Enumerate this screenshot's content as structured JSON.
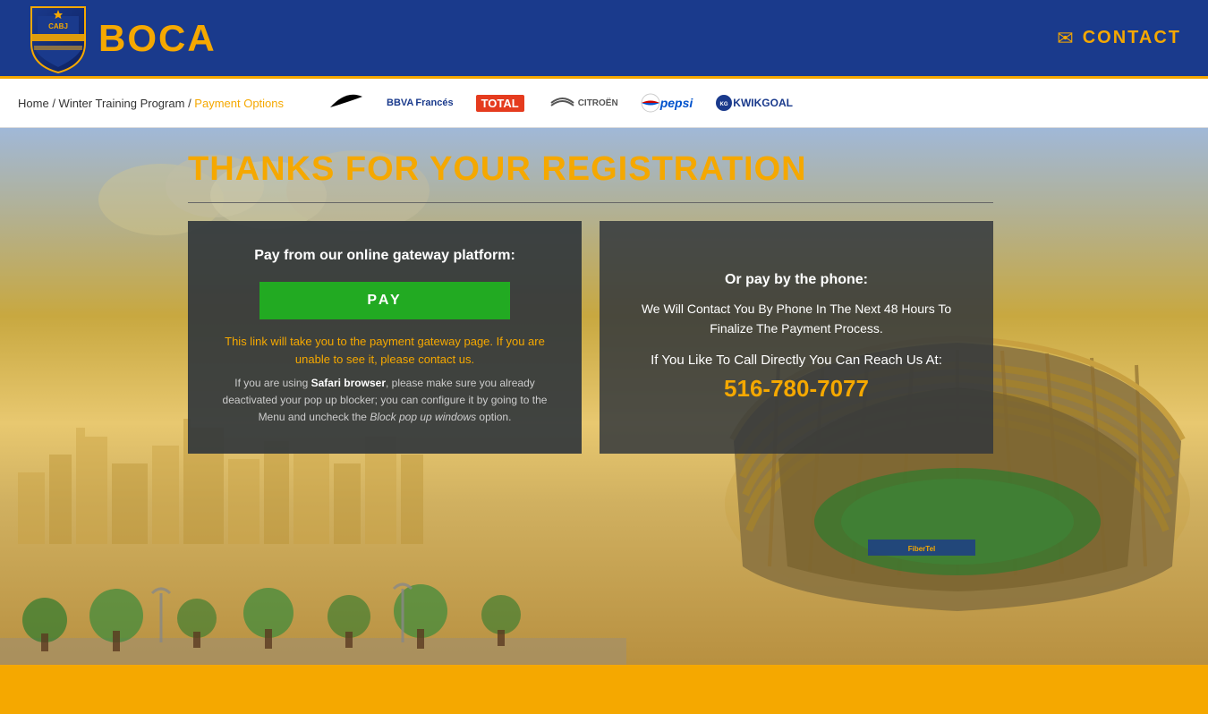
{
  "header": {
    "logo_text": "BOCA",
    "contact_label": "CONTACT",
    "contact_icon": "✉"
  },
  "nav": {
    "breadcrumb": {
      "home": "Home",
      "program": "Winter Training Program",
      "current": "Payment Options",
      "separator": "/"
    },
    "sponsors": [
      {
        "name": "Nike",
        "display": "✓",
        "type": "nike"
      },
      {
        "name": "BBVA Francés",
        "display": "BBVA Francés",
        "type": "bbva"
      },
      {
        "name": "Total",
        "display": "TOTAL",
        "type": "total"
      },
      {
        "name": "Citroën",
        "display": "CITROËN",
        "type": "citroen"
      },
      {
        "name": "Pepsi",
        "display": "pepsi",
        "type": "pepsi"
      },
      {
        "name": "KwikGoal",
        "display": "KWIKGOAL",
        "type": "kwikgoal"
      }
    ]
  },
  "main": {
    "page_title": "THANKS FOR YOUR REGISTRATION",
    "card_left": {
      "title": "Pay from our online gateway platform:",
      "pay_button": "PAY",
      "warning": "This link will take you to the payment gateway page. If you are unable to see it, please contact us.",
      "info_part1": "If you are using ",
      "info_safari": "Safari browser",
      "info_part2": ", please make sure you already deactivated your pop up blocker; you can configure it by going to the Menu and uncheck the ",
      "info_block": "Block pop up windows",
      "info_part3": " option."
    },
    "card_right": {
      "title": "Or pay by the phone:",
      "description": "We Will Contact You By Phone In The Next 48 Hours To Finalize The Payment Process.",
      "call_text": "If You Like To Call Directly You Can Reach Us At:",
      "phone": "516-780-7077"
    }
  },
  "footer": {}
}
